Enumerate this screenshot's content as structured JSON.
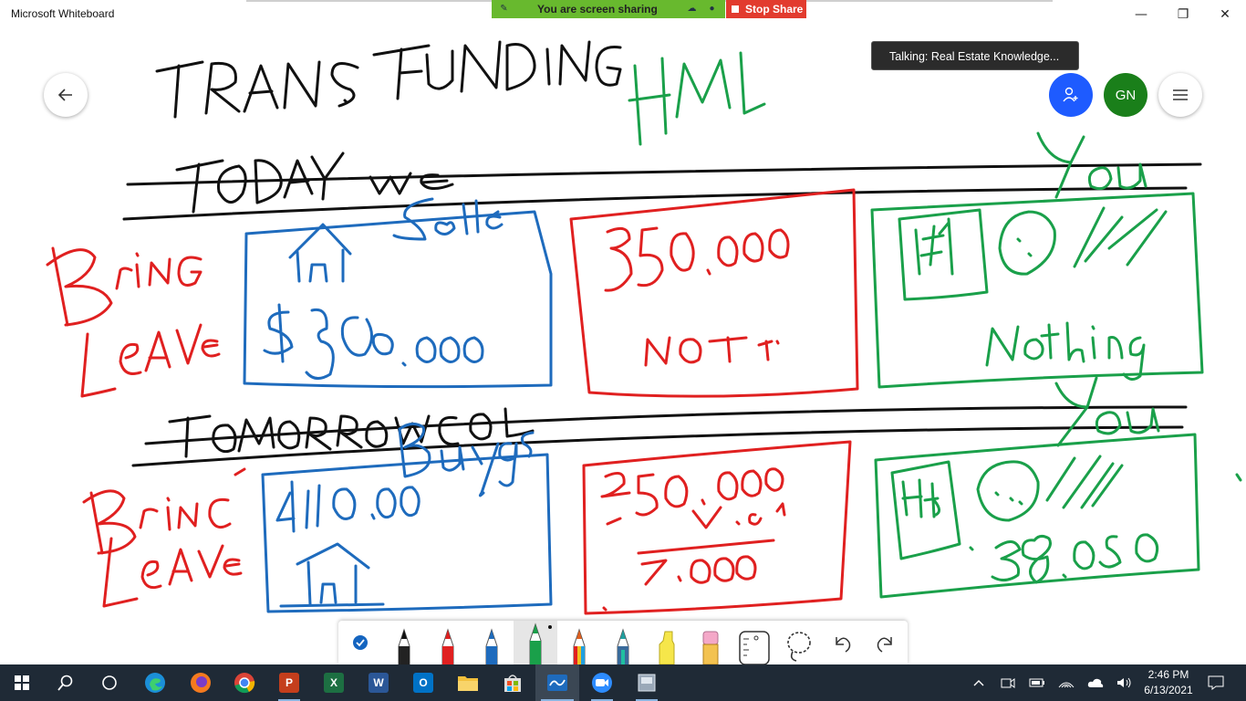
{
  "app": {
    "title": "Microsoft Whiteboard"
  },
  "window_controls": {
    "minimize": "—",
    "restore": "❐",
    "close": "✕"
  },
  "screen_share": {
    "status": "You are screen sharing",
    "stop_label": "Stop Share",
    "color": "#68b92e",
    "stop_color": "#e23b2e"
  },
  "tooltip": {
    "text": "Talking: Real Estate Knowledge..."
  },
  "participants": {
    "invite_icon": "person-add-icon",
    "avatar_initials": "GN",
    "avatar_color": "#1a7f1a",
    "invite_color": "#1e5bff"
  },
  "toolbar": {
    "tools": [
      "select",
      "black-pen",
      "red-pen",
      "blue-pen",
      "green-pen",
      "rainbow-pen",
      "galaxy-pen",
      "highlighter",
      "eraser",
      "ruler",
      "lasso",
      "undo",
      "redo"
    ],
    "selected": "green-pen"
  },
  "taskbar": {
    "apps": [
      "start",
      "search",
      "task-view",
      "edge",
      "firefox",
      "chrome",
      "powerpoint",
      "excel",
      "word",
      "outlook",
      "file-explorer",
      "store",
      "whiteboard",
      "zoom",
      "other-app"
    ],
    "tile_letters": {
      "powerpoint": "P",
      "excel": "X",
      "word": "W",
      "outlook": "O"
    }
  },
  "clock": {
    "time": "2:46 PM",
    "date": "6/13/2021"
  }
}
